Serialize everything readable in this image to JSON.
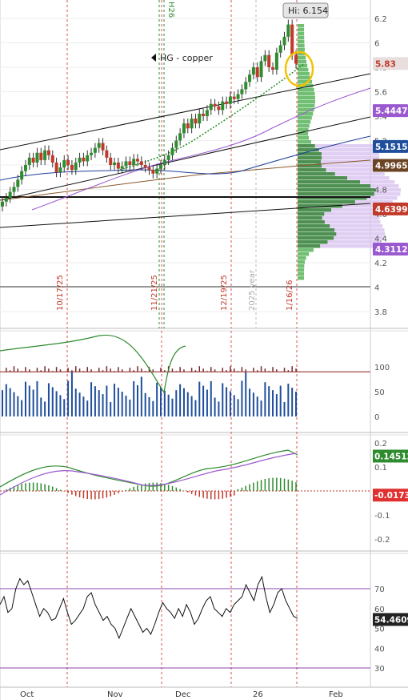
{
  "chart_data": {
    "type": "candlestick",
    "instrument": "HG - copper",
    "contract_marker": "H26",
    "hi_label": "Hi: 6.154",
    "year_label": "2025 year",
    "price_axis": {
      "ylim": [
        3.65,
        6.3
      ],
      "ticks": [
        "6.2",
        "6",
        "5.8",
        "5.6",
        "5.4",
        "5.2",
        "5",
        "4.8",
        "4.6",
        "4.4",
        "4.2",
        "4",
        "3.8"
      ]
    },
    "price_badges": [
      {
        "value": "5.83",
        "color": "#e8dede",
        "text_color": "#c0392b"
      },
      {
        "value": "5.4447",
        "color": "#9b59d0",
        "text_color": "#ffffff"
      },
      {
        "value": "5.1515",
        "color": "#1f4e9c",
        "text_color": "#ffffff"
      },
      {
        "value": "4.9965",
        "color": "#6b4423",
        "text_color": "#ffffff"
      },
      {
        "value": "4.6399",
        "color": "#c0392b",
        "text_color": "#ffffff"
      },
      {
        "value": "4.3112",
        "color": "#9b59d0",
        "text_color": "#ffffff"
      }
    ],
    "date_markers": [
      "10/17/25",
      "11/21/25",
      "12/19/25",
      "1/16/26"
    ],
    "x_axis_labels": [
      "Oct",
      "Nov",
      "Dec",
      "26",
      "Feb"
    ],
    "ohlc_close": [
      4.7,
      4.73,
      4.78,
      4.82,
      4.88,
      4.95,
      5.0,
      5.06,
      5.02,
      5.1,
      5.04,
      5.12,
      5.08,
      5.02,
      4.94,
      4.98,
      5.04,
      5.0,
      4.96,
      5.02,
      5.06,
      5.03,
      5.08,
      5.1,
      5.14,
      5.18,
      5.12,
      5.06,
      5.0,
      5.02,
      4.97,
      4.99,
      5.03,
      5.0,
      5.05,
      5.03,
      5.0,
      4.98,
      4.96,
      4.93,
      4.97,
      5.0,
      5.04,
      5.08,
      5.14,
      5.2,
      5.26,
      5.34,
      5.3,
      5.38,
      5.34,
      5.42,
      5.4,
      5.45,
      5.5,
      5.48,
      5.45,
      5.52,
      5.5,
      5.56,
      5.54,
      5.58,
      5.62,
      5.68,
      5.74,
      5.8,
      5.72,
      5.85,
      5.9,
      5.8,
      5.78,
      5.92,
      5.98,
      6.05,
      6.15,
      5.9,
      5.83
    ],
    "volume_panel": {
      "ticks": [
        "100",
        "50",
        "0"
      ],
      "level_line": 90
    },
    "macd_panel": {
      "ticks": [
        "0.2",
        "0.1",
        "0",
        "-0.1",
        "-0.2"
      ],
      "badges": [
        {
          "value": "0.14512",
          "color": "#2e8b2e"
        },
        {
          "value": "-0.0173",
          "color": "#e03030"
        }
      ]
    },
    "rsi_panel": {
      "ticks": [
        "70",
        "60",
        "50",
        "40",
        "30"
      ],
      "badges": [
        {
          "value": "54.4609",
          "color": "#222222"
        }
      ],
      "rsi": [
        62,
        66,
        58,
        60,
        70,
        75,
        72,
        74,
        68,
        62,
        56,
        60,
        58,
        54,
        55,
        60,
        65,
        58,
        52,
        54,
        57,
        60,
        66,
        68,
        62,
        58,
        54,
        56,
        52,
        50,
        45,
        50,
        55,
        60,
        56,
        52,
        48,
        50,
        47,
        52,
        58,
        63,
        60,
        58,
        55,
        60,
        56,
        62,
        58,
        52,
        55,
        60,
        64,
        66,
        60,
        58,
        56,
        60,
        58,
        62,
        64,
        66,
        72,
        68,
        64,
        72,
        76,
        66,
        58,
        62,
        68,
        70,
        64,
        60,
        56,
        55
      ]
    }
  }
}
